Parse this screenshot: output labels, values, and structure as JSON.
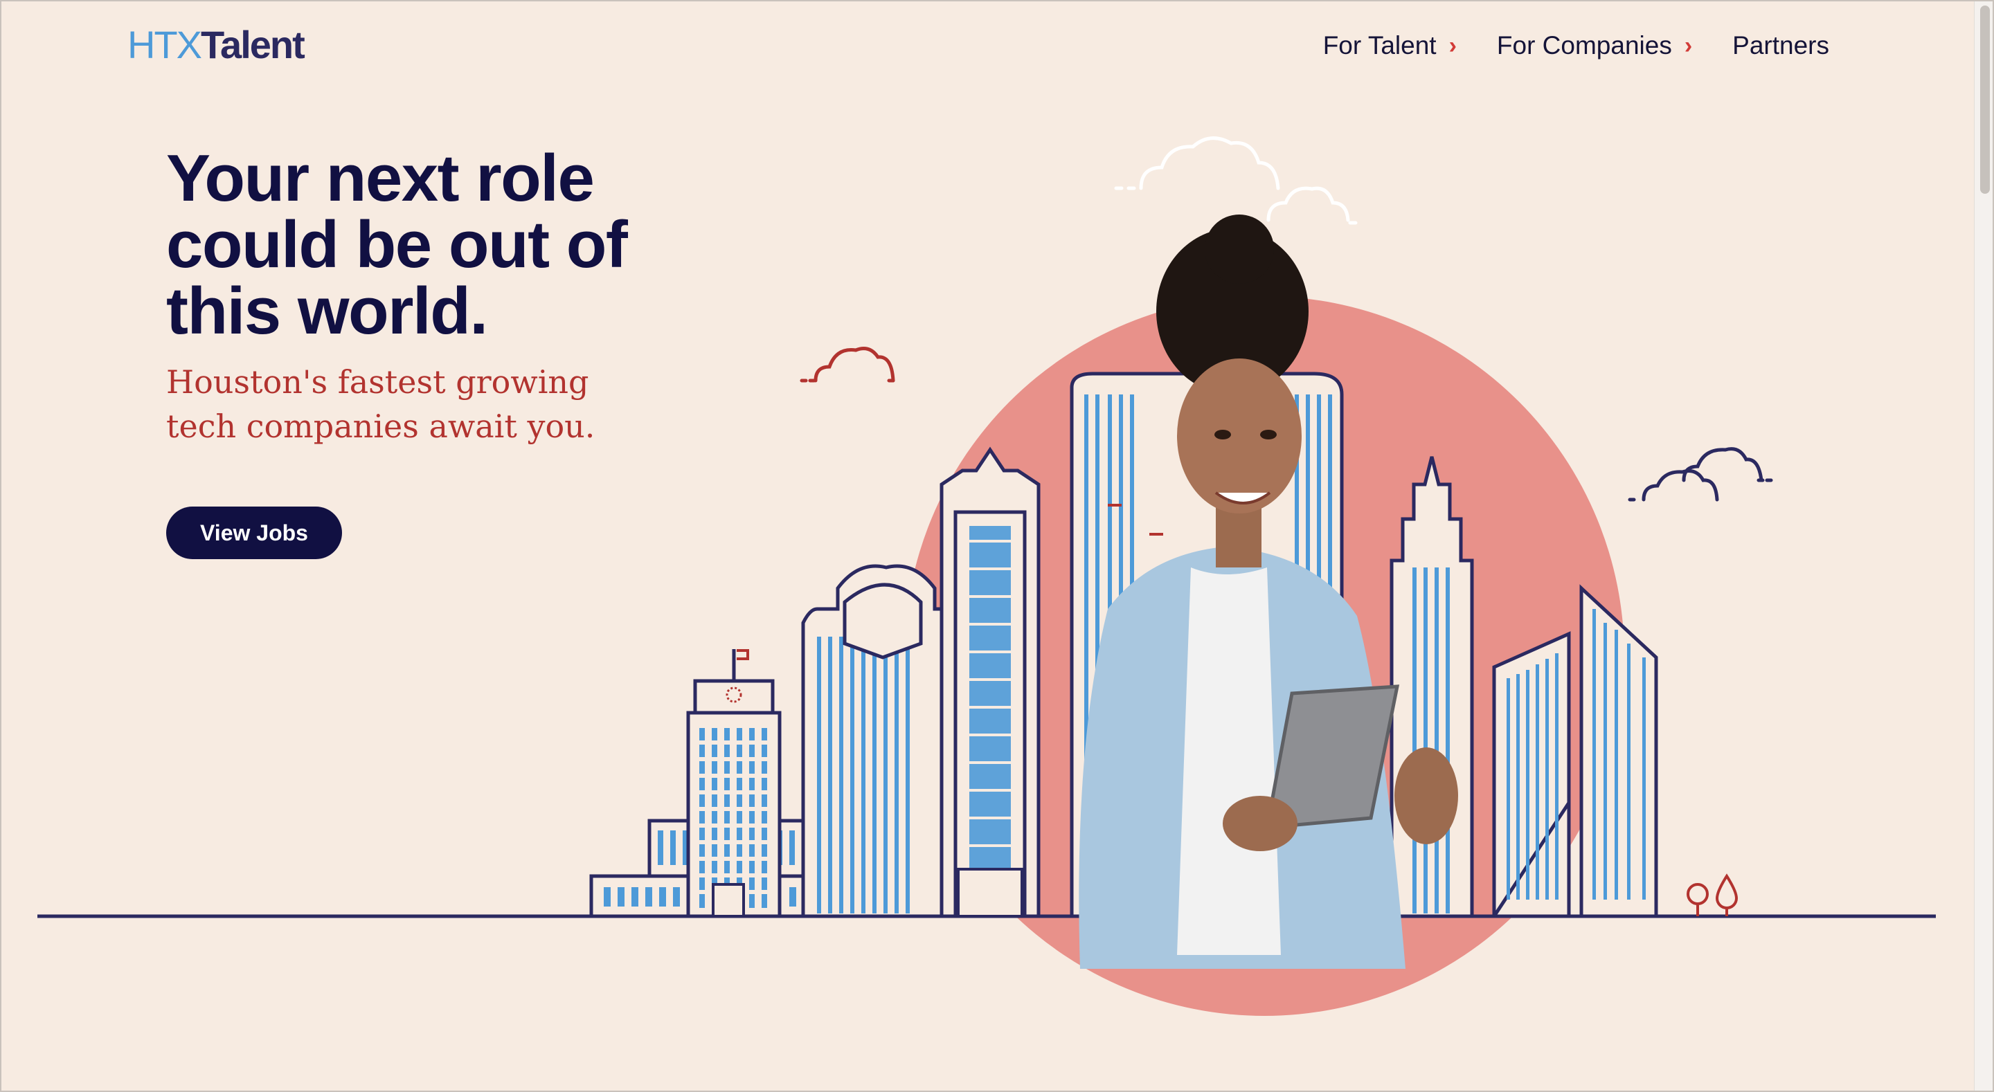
{
  "brand": {
    "logo_prefix": "HTX",
    "logo_suffix": "Talent"
  },
  "nav": {
    "items": [
      {
        "label": "For Talent",
        "has_submenu": true
      },
      {
        "label": "For Companies",
        "has_submenu": true
      },
      {
        "label": "Partners",
        "has_submenu": false
      }
    ]
  },
  "hero": {
    "headline_line1": "Your next role",
    "headline_line2": "could be out of",
    "headline_line3": "this world.",
    "subhead_line1": "Houston's fastest growing",
    "subhead_line2": "tech companies await you.",
    "cta_label": "View Jobs"
  },
  "colors": {
    "background": "#f7ebe1",
    "navy": "#111042",
    "accent_red": "#b2332f",
    "circle_coral": "#e8918a",
    "building_blue": "#4d9ad8"
  },
  "icons": {
    "nav_chevron": "chevron-right-icon"
  }
}
